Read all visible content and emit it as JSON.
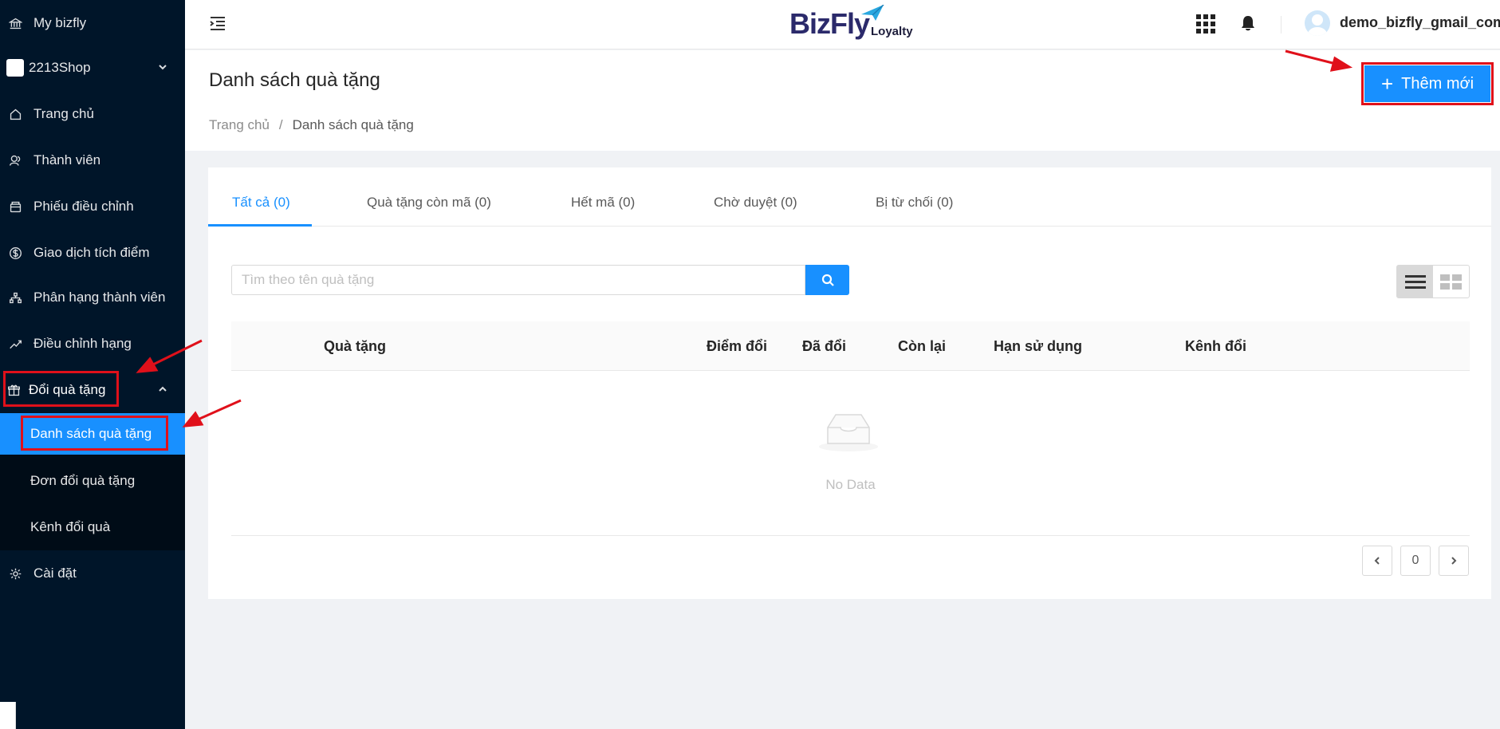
{
  "sidebar": {
    "items": [
      {
        "label": "My bizfly",
        "icon": "bank-icon"
      },
      {
        "label": "2213Shop",
        "icon": "shop-avatar"
      },
      {
        "label": "Trang chủ",
        "icon": "home-icon"
      },
      {
        "label": "Thành viên",
        "icon": "members-icon"
      },
      {
        "label": "Phiếu điều chỉnh",
        "icon": "wallet-icon"
      },
      {
        "label": "Giao dịch tích điểm",
        "icon": "dollar-icon"
      },
      {
        "label": "Phân hạng thành viên",
        "icon": "tier-icon"
      },
      {
        "label": "Điều chỉnh hạng",
        "icon": "trend-icon"
      },
      {
        "label": "Đổi quà tặng",
        "icon": "gift-icon"
      },
      {
        "label": "Cài đặt",
        "icon": "gear-icon"
      }
    ],
    "submenu": [
      {
        "label": "Danh sách quà tặng",
        "active": true
      },
      {
        "label": "Đơn đổi quà tặng",
        "active": false
      },
      {
        "label": "Kênh đổi quà",
        "active": false
      }
    ]
  },
  "header": {
    "brand": "BizFly",
    "brand_sub": "Loyalty",
    "username": "demo_bizfly_gmail_com"
  },
  "page": {
    "title": "Danh sách quà tặng",
    "breadcrumb": {
      "home": "Trang chủ",
      "separator": "/",
      "current": "Danh sách quà tặng"
    },
    "add_button": "Thêm mới"
  },
  "tabs": [
    {
      "label": "Tất cả (0)",
      "active": true
    },
    {
      "label": "Quà tặng còn mã (0)",
      "active": false
    },
    {
      "label": "Hết mã (0)",
      "active": false
    },
    {
      "label": "Chờ duyệt (0)",
      "active": false
    },
    {
      "label": "Bị từ chối (0)",
      "active": false
    }
  ],
  "search": {
    "placeholder": "Tìm theo tên quà tặng",
    "value": ""
  },
  "table": {
    "columns": [
      "Quà tặng",
      "Điểm đổi",
      "Đã đổi",
      "Còn lại",
      "Hạn sử dụng",
      "Kênh đổi"
    ],
    "empty_text": "No Data"
  },
  "pagination": {
    "current": "0"
  },
  "colors": {
    "sidebar_bg": "#001529",
    "accent": "#1890ff",
    "highlight": "#e0101a"
  }
}
